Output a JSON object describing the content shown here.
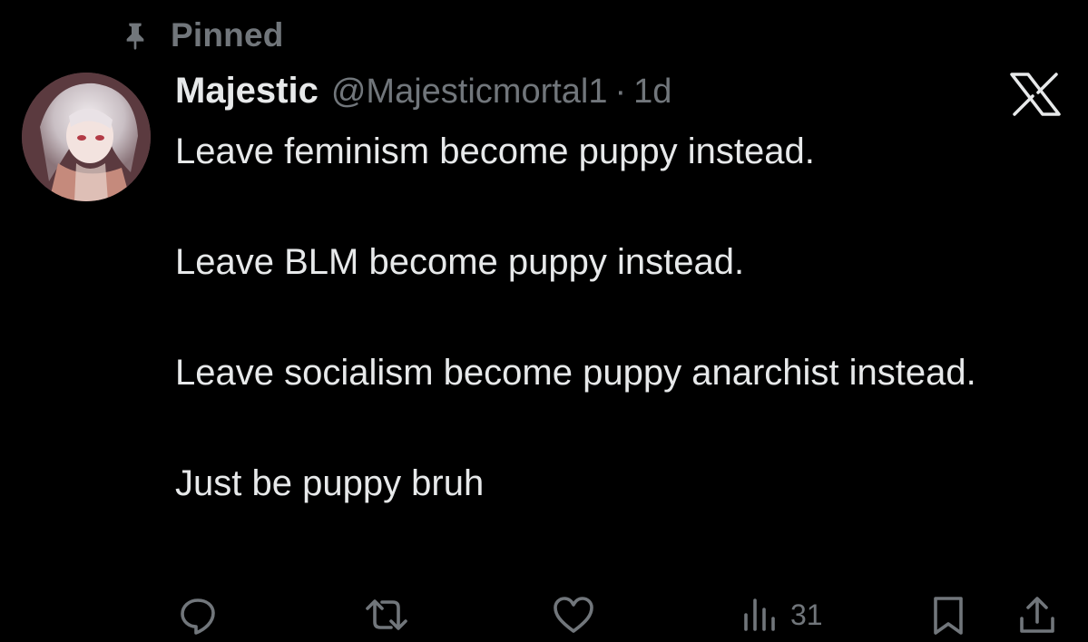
{
  "pinned": {
    "label": "Pinned",
    "icon": "pin-icon"
  },
  "author": {
    "display_name": "Majestic",
    "handle": "@Majesticmortal1",
    "separator": "·",
    "timestamp": "1d"
  },
  "tweet": {
    "paragraphs": [
      "Leave feminism become puppy instead.",
      "Leave BLM become puppy instead.",
      "Leave socialism become puppy anarchist instead.",
      "Just be puppy bruh"
    ]
  },
  "actions": {
    "reply_icon": "reply-icon",
    "retweet_icon": "retweet-icon",
    "like_icon": "heart-icon",
    "views_icon": "views-icon",
    "views_count": "31",
    "bookmark_icon": "bookmark-icon",
    "share_icon": "share-icon"
  },
  "brand": {
    "logo": "x-logo-icon"
  },
  "colors": {
    "background": "#000000",
    "text_primary": "#e7e9ea",
    "text_secondary": "#71767b"
  }
}
